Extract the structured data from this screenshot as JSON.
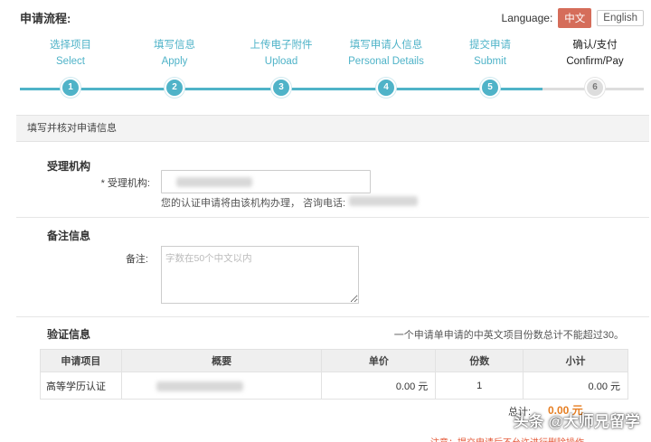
{
  "header": {
    "title": "申请流程:",
    "language_label": "Language:",
    "lang_options": [
      "中文",
      "English"
    ],
    "active_lang": "中文"
  },
  "steps": [
    {
      "cn": "选择项目",
      "en": "Select",
      "num": "1"
    },
    {
      "cn": "填写信息",
      "en": "Apply",
      "num": "2"
    },
    {
      "cn": "上传电子附件",
      "en": "Upload",
      "num": "3"
    },
    {
      "cn": "填写申请人信息",
      "en": "Personal Details",
      "num": "4"
    },
    {
      "cn": "提交申请",
      "en": "Submit",
      "num": "5"
    },
    {
      "cn": "确认/支付",
      "en": "Confirm/Pay",
      "num": "6"
    }
  ],
  "current_step": "6",
  "panel": {
    "heading": "填写并核对申请信息"
  },
  "agency": {
    "section_title": "受理机构",
    "field_label": "* 受理机构:",
    "hint": "您的认证申请将由该机构办理，  咨询电话:"
  },
  "remark": {
    "section_title": "备注信息",
    "field_label": "备注:",
    "placeholder": "字数在50个中文以内"
  },
  "verify": {
    "section_title": "验证信息",
    "note": "一个申请单申请的中英文项目份数总计不能超过30。",
    "columns": [
      "申请项目",
      "概要",
      "单价",
      "份数",
      "小计"
    ],
    "rows": [
      {
        "item": "高等学历认证",
        "price": "0.00 元",
        "qty": "1",
        "subtotal": "0.00 元"
      }
    ],
    "total_label": "总计:",
    "total_value": "0.00 元"
  },
  "footer_warning": "注意：提交申请后不允许进行删除操作",
  "watermark": "头条 @大师兄留学",
  "colors": {
    "accent": "#4fb3c8",
    "lang_active": "#d56d5a",
    "total": "#e67e22",
    "warning": "#e55a3a"
  }
}
